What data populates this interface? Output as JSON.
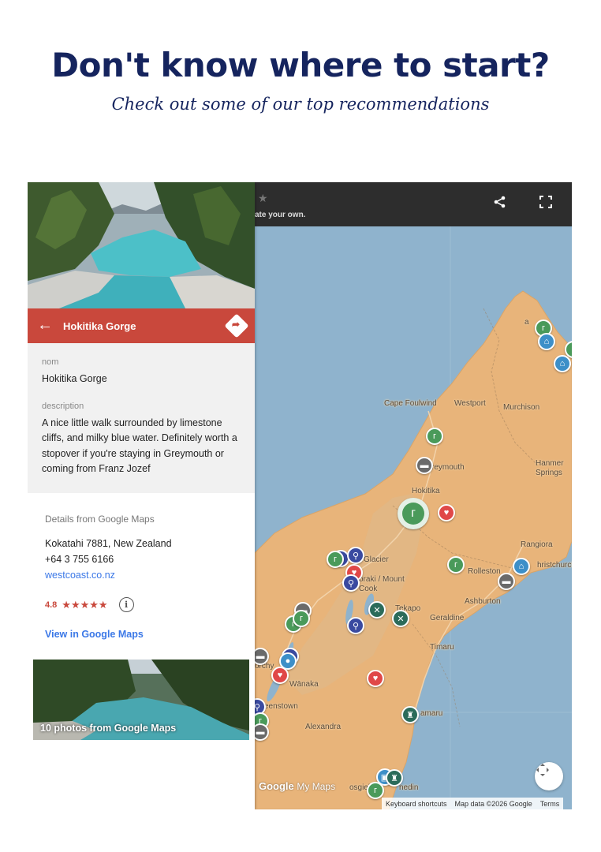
{
  "header": {
    "title": "Don't know where to start?",
    "subtitle": "Check out some of our top recommendations"
  },
  "map": {
    "topbar": {
      "hint": "ate your own.",
      "icons": [
        "star-icon",
        "share-icon",
        "fullscreen-icon"
      ]
    },
    "labels": {
      "cape_foulwind": "Cape Foulwind",
      "westport": "Westport",
      "murchison": "Murchison",
      "greymouth": "reymouth",
      "hanmer": "Hanmer Springs",
      "hokitika": "Hokitika",
      "rangiora": "Rangiora",
      "glacier": "Glacier",
      "rolleston": "Rolleston",
      "christchurch": "hristchurch",
      "aoraki": "oraki / Mount Cook",
      "ashburton": "Ashburton",
      "tekapo": "Tekapo",
      "geraldine": "Geraldine",
      "timaru": "Timaru",
      "wanaka": "Wānaka",
      "queenstown": "eenstown",
      "alexandra": "Alexandra",
      "oamaru": "amaru",
      "dunedin": "nedin",
      "mosgiel": "osgiel",
      "borchy": "orchy",
      "nelson": "a"
    },
    "brand": {
      "google": "Google",
      "mymaps": "My Maps"
    },
    "attribution": {
      "shortcuts": "Keyboard shortcuts",
      "mapdata": "Map data ©2026 Google",
      "terms": "Terms"
    },
    "colors": {
      "water": "#8fb3cd",
      "land": "#e8b47a",
      "topbar": "#2d2d2d"
    }
  },
  "panel": {
    "title": "Hokitika Gorge",
    "fields": {
      "name_label": "nom",
      "name_value": "Hokitika Gorge",
      "description_label": "description",
      "description_value": "A nice little walk surrounded by limestone cliffs, and milky blue water. Definitely worth a stopover if you're staying in Greymouth or coming from Franz Jozef"
    },
    "google": {
      "heading": "Details from Google Maps",
      "address": "Kokatahi 7881, New Zealand",
      "phone": "+64 3 755 6166",
      "website": "westcoast.co.nz",
      "rating": "4.8",
      "stars": "★★★★★",
      "view_link": "View in Google Maps",
      "photos_caption": "10 photos from Google Maps"
    },
    "colors": {
      "titlebar": "#c9483c",
      "link": "#3b78e7"
    }
  }
}
